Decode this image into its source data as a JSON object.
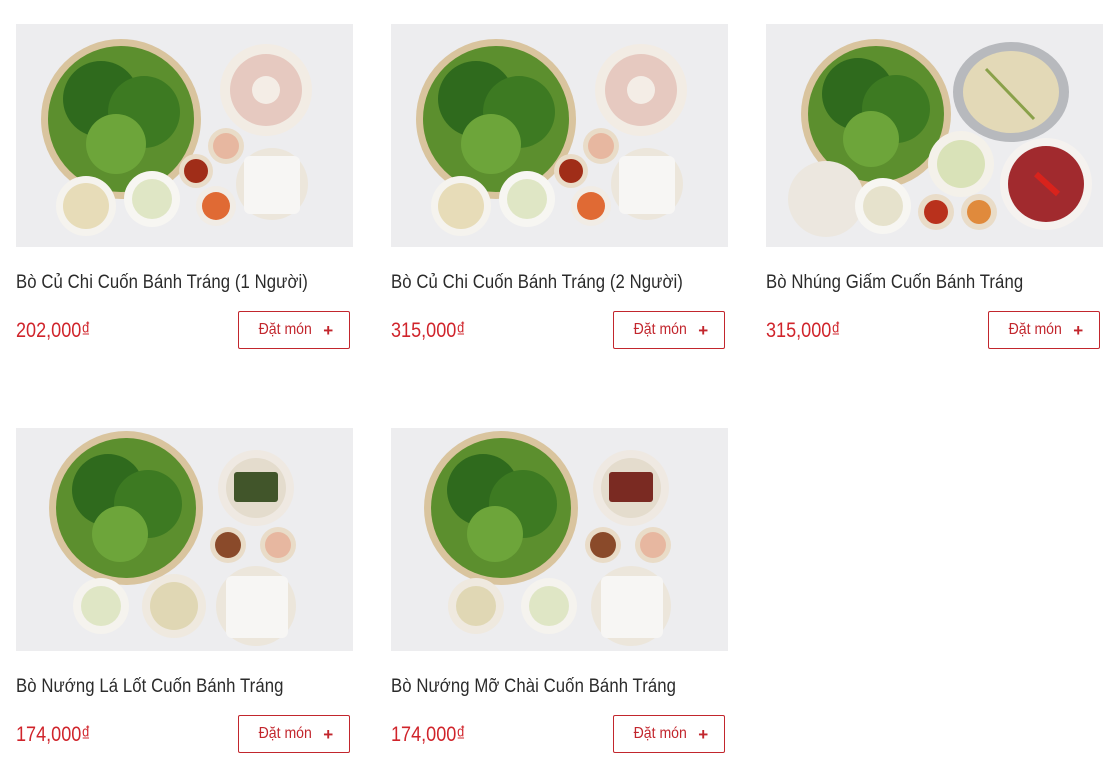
{
  "menu": {
    "order_label": "Đặt món",
    "plus_glyph": "+",
    "items": [
      {
        "name": "Bò Củ Chi Cuốn Bánh Tráng (1 Người)",
        "price": "202,000₫",
        "image": "banh-trang-beef-platter-photo"
      },
      {
        "name": "Bò Củ Chi Cuốn Bánh Tráng (2 Người)",
        "price": "315,000₫",
        "image": "banh-trang-beef-platter-photo"
      },
      {
        "name": "Bò Nhúng Giấm Cuốn Bánh Tráng",
        "price": "315,000₫",
        "image": "vinegar-hotpot-beef-photo"
      },
      {
        "name": "Bò Nướng Lá Lốt Cuốn Bánh Tráng",
        "price": "174,000₫",
        "image": "la-lot-grilled-beef-photo"
      },
      {
        "name": "Bò Nướng Mỡ Chài Cuốn Bánh Tráng",
        "price": "174,000₫",
        "image": "mo-chai-grilled-beef-photo"
      }
    ]
  },
  "colors": {
    "accent": "#c2262d",
    "price": "#d0242b",
    "text": "#2b2b2b",
    "photo_bg": "#ededef"
  }
}
